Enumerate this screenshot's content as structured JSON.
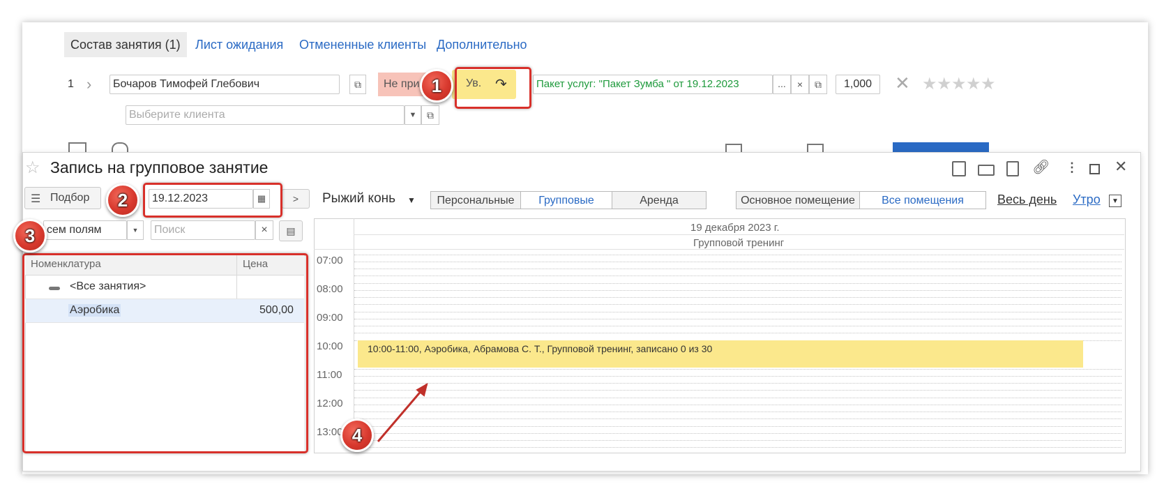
{
  "tabs": [
    {
      "label": "Состав занятия (1)",
      "active": true
    },
    {
      "label": "Лист ожидания"
    },
    {
      "label": "Отмененные клиенты"
    },
    {
      "label": "Дополнительно"
    }
  ],
  "client_row": {
    "num": "1",
    "client_name": "Бочаров Тимофей Глебович",
    "status_label": "Не при",
    "uv_label": "Ув.",
    "package": "Пакет услуг: \"Пакет Зумба \" от 19.12.2023",
    "package_more": "...",
    "package_clear": "×",
    "quantity": "1,000",
    "remove": "✕",
    "rating": 0
  },
  "select_client": {
    "placeholder": "Выберите клиента"
  },
  "dialog": {
    "title": "Запись на групповое занятие",
    "pick_label": "Подбор",
    "date": "19.12.2023",
    "next": ">",
    "trainer": "Рыжий конь",
    "type_filters": [
      "Персональные",
      "Групповые",
      "Аренда"
    ],
    "type_selected": "Групповые",
    "room_filters": [
      "Основное помещение",
      "Все помещения"
    ],
    "room_selected": "Все помещения",
    "whole_day": "Весь день",
    "morning": "Утро"
  },
  "search": {
    "field_value": "сем полям",
    "placeholder": "Поиск",
    "clear": "×"
  },
  "catalog": {
    "columns": [
      "Номенклатура",
      "Цена"
    ],
    "rows": [
      {
        "name": "<Все занятия>",
        "price": "",
        "group": true
      },
      {
        "name": "Аэробика",
        "price": "500,00",
        "selected": true
      }
    ]
  },
  "schedule": {
    "date_header": "19 декабря 2023 г.",
    "category_header": "Групповой тренинг",
    "hours": [
      "07:00",
      "08:00",
      "09:00",
      "10:00",
      "11:00",
      "12:00",
      "13:00"
    ],
    "event": "10:00-11:00, Аэробика, Абрамова С. Т., Групповой тренинг, записано 0 из 30",
    "event_color": "#fbe88c"
  },
  "badges": [
    "1",
    "2",
    "3",
    "4"
  ],
  "colors": {
    "accent": "#2a6ac4",
    "highlight": "#d8302a",
    "status_bg": "#f7c3b9",
    "uv_bg": "#fbe88c",
    "package_text": "#1e9a3c",
    "selected_row": "#e8f0fb"
  }
}
